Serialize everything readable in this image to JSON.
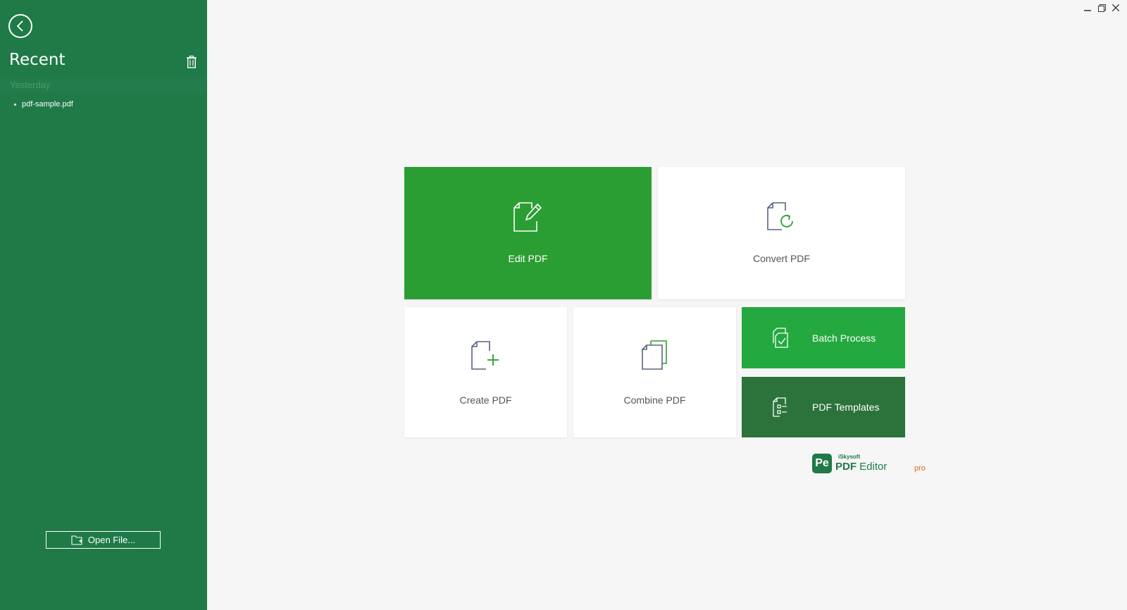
{
  "sidebar": {
    "title": "Recent",
    "group_label": "Yesterday",
    "items": [
      {
        "label": "pdf-sample.pdf"
      }
    ],
    "open_file_label": "Open File..."
  },
  "tiles": {
    "edit": {
      "label": "Edit PDF"
    },
    "convert": {
      "label": "Convert PDF"
    },
    "create": {
      "label": "Create PDF"
    },
    "combine": {
      "label": "Combine PDF"
    },
    "batch": {
      "label": "Batch Process"
    },
    "templates": {
      "label": "PDF Templates"
    }
  },
  "brand": {
    "badge": "Pe",
    "maker": "iSkysoft",
    "name_bold": "PDF",
    "name_thin": "Editor",
    "edition": "pro"
  },
  "colors": {
    "sidebar": "#1f7a48",
    "edit_tile": "#2b9e33",
    "batch_tile": "#23a93f",
    "templates_tile": "#2b733b",
    "brand_accent": "#e06a1b"
  }
}
